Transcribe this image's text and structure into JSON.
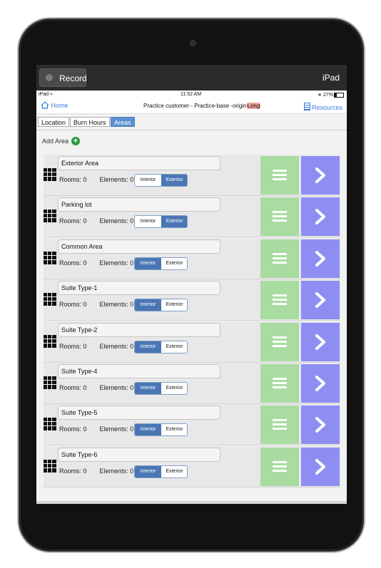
{
  "recording": {
    "record_label": "Record",
    "device_label": "iPad"
  },
  "status_bar": {
    "left": "iPad",
    "time": "11:52 AM",
    "battery": "27%"
  },
  "nav": {
    "home_label": "Home",
    "title_prefix": "Practice customer - Practice-base -origin",
    "title_highlight": "Long",
    "resources_label": "Resources"
  },
  "tabs": [
    {
      "label": "Location",
      "active": false
    },
    {
      "label": "Burn Hours",
      "active": false
    },
    {
      "label": "Areas",
      "active": true
    }
  ],
  "add_area_label": "Add Area",
  "labels": {
    "rooms": "Rooms:",
    "elements": "Elements:",
    "interior": "Interior",
    "exterior": "Exterior"
  },
  "areas": [
    {
      "name": "Exterior Area",
      "rooms": 0,
      "elements": 0,
      "selected": "Exterior"
    },
    {
      "name": "Parking lot",
      "rooms": 0,
      "elements": 0,
      "selected": "Exterior"
    },
    {
      "name": "Common Area",
      "rooms": 0,
      "elements": 0,
      "selected": "Interior"
    },
    {
      "name": "Suite Type-1",
      "rooms": 0,
      "elements": 0,
      "selected": "Interior"
    },
    {
      "name": "Suite Type-2",
      "rooms": 0,
      "elements": 0,
      "selected": "Interior"
    },
    {
      "name": "Suite Type-4",
      "rooms": 0,
      "elements": 0,
      "selected": "Interior"
    },
    {
      "name": "Suite Type-5",
      "rooms": 0,
      "elements": 0,
      "selected": "Interior"
    },
    {
      "name": "Suite Type-6",
      "rooms": 0,
      "elements": 0,
      "selected": "Interior"
    }
  ],
  "colors": {
    "accent": "#3d7bd8",
    "menu_button": "#a8dca0",
    "go_button": "#8e8ef2",
    "segment_on": "#4a77b3"
  }
}
